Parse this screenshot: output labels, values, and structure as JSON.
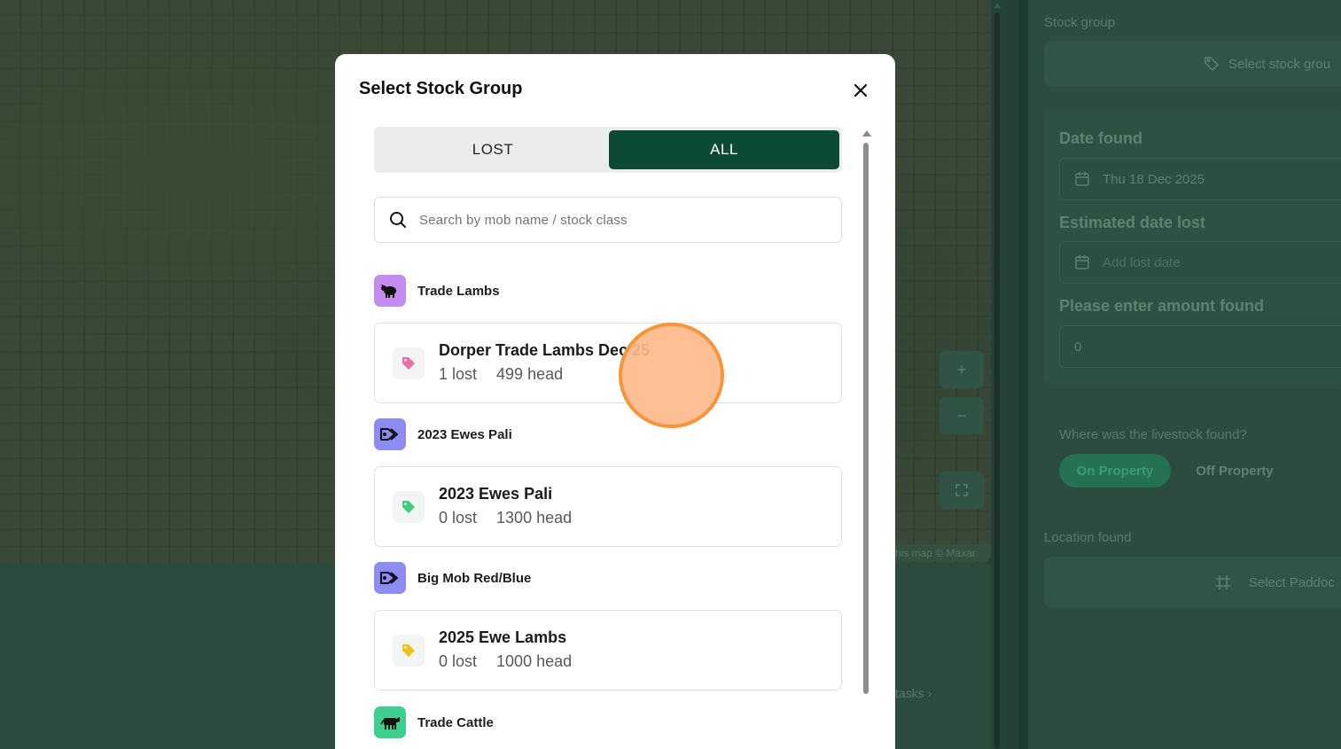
{
  "background": {
    "attribution": "his map © Maxar",
    "tasks_link": "tasks",
    "map_controls": {
      "zoom_in": "+",
      "zoom_out": "−"
    },
    "side_panel": {
      "stock_group_label": "Stock group",
      "stock_group_button": "Select stock grou",
      "date_found_label": "Date found",
      "date_found_value": "Thu 18 Dec 2025",
      "estimated_date_lost_label": "Estimated date lost",
      "estimated_date_lost_placeholder": "Add lost date",
      "amount_found_label": "Please enter amount found",
      "amount_found_value": "0",
      "location_question": "Where was the livestock found?",
      "on_property": "On Property",
      "off_property": "Off Property",
      "location_found_label": "Location found",
      "paddock_button": "Select Paddoc"
    }
  },
  "modal": {
    "title": "Select Stock Group",
    "tabs": {
      "lost": "LOST",
      "all": "ALL",
      "active": "ALL"
    },
    "search_placeholder": "Search by mob name / stock class",
    "groups": [
      {
        "name": "Trade Lambs",
        "icon": "sheep-icon",
        "icon_bg": "#c48af0",
        "items": [
          {
            "title": "Dorper Trade Lambs Dec 25",
            "lost": "1 lost",
            "head": "499 head",
            "tag_color": "#ec6fa7"
          }
        ]
      },
      {
        "name": "2023 Ewes Pali",
        "icon": "tags-icon",
        "icon_bg": "#8d8cf3",
        "items": [
          {
            "title": "2023 Ewes Pali",
            "lost": "0 lost",
            "head": "1300 head",
            "tag_color": "#3fcf7a"
          }
        ]
      },
      {
        "name": "Big Mob Red/Blue",
        "icon": "tags-icon",
        "icon_bg": "#8d8cf3",
        "items": [
          {
            "title": "2025 Ewe Lambs",
            "lost": "0 lost",
            "head": "1000 head",
            "tag_color": "#f1c21b"
          }
        ]
      },
      {
        "name": "Trade Cattle",
        "icon": "cow-icon",
        "icon_bg": "#3ccf8e",
        "items": []
      }
    ]
  },
  "colors": {
    "accent": "#0c4a36",
    "click_indicator": "#f7953a"
  }
}
